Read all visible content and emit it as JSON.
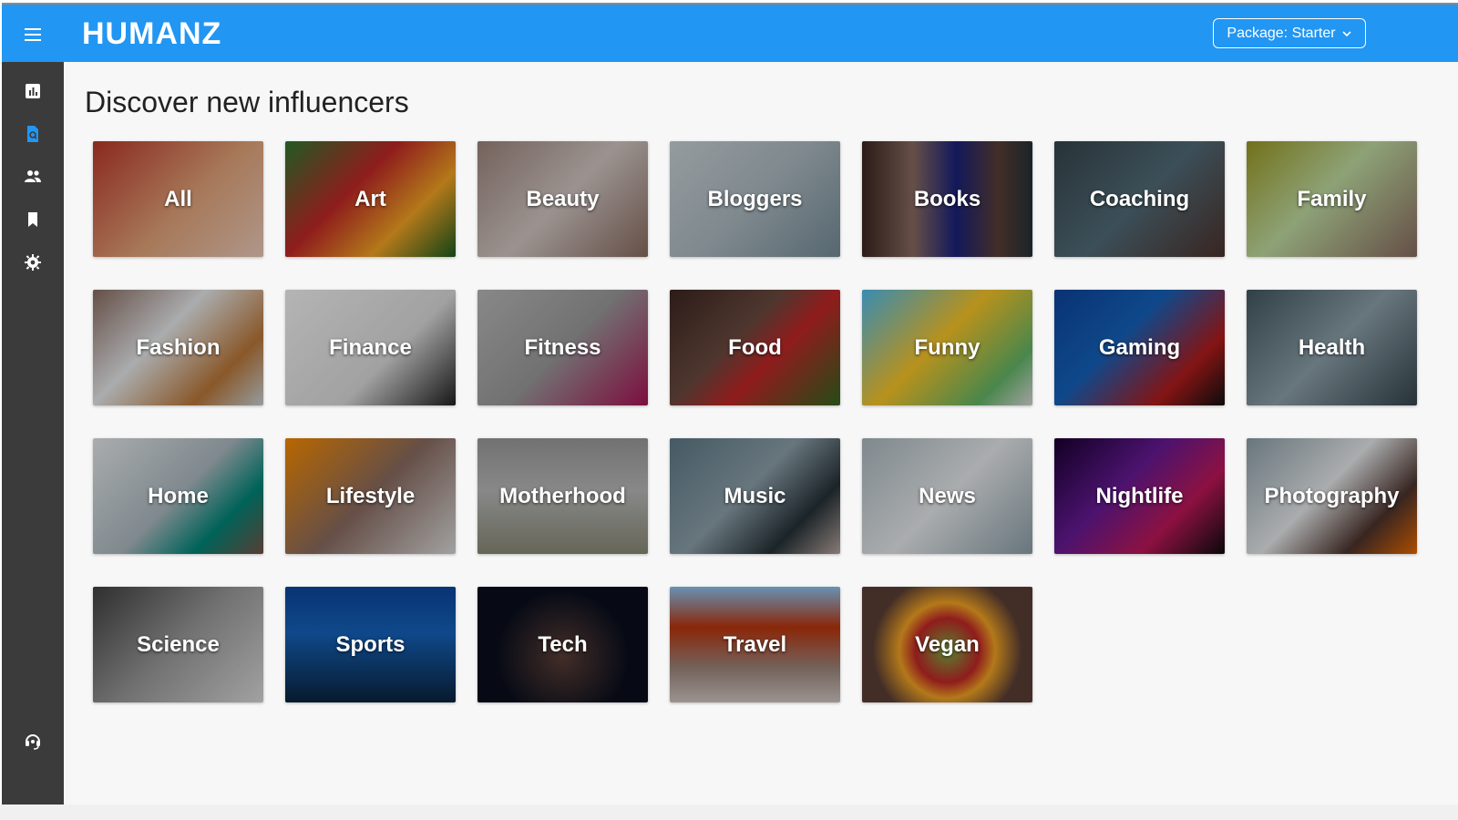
{
  "header": {
    "logo_text": "HUMANZ",
    "package_label": "Package: Starter"
  },
  "page": {
    "title": "Discover new influencers"
  },
  "colors": {
    "brand_blue": "#2196f3",
    "sidebar_bg": "#3b3b3b",
    "page_bg": "#f7f7f7"
  },
  "sidebar": {
    "items": [
      {
        "icon": "bar-chart-icon",
        "active": false
      },
      {
        "icon": "search-document-icon",
        "active": true
      },
      {
        "icon": "people-icon",
        "active": false
      },
      {
        "icon": "bookmark-icon",
        "active": false
      },
      {
        "icon": "gear-icon",
        "active": false
      }
    ],
    "bottom_icon": "support-headset-icon"
  },
  "categories": [
    {
      "label": "All",
      "bg": "linear-gradient(135deg,#c0392b,#e8a87c 55%,#f3d1c0)"
    },
    {
      "label": "Art",
      "bg": "linear-gradient(135deg,#2e7d32,#c62828 40%,#f9a825 70%,#1b5e20)"
    },
    {
      "label": "Beauty",
      "bg": "linear-gradient(135deg,#a1887f,#d7ccc8 50%,#8d6e63)"
    },
    {
      "label": "Bloggers",
      "bg": "linear-gradient(135deg,#cfd8dc,#b0bec5 50%,#78909c)"
    },
    {
      "label": "Books",
      "bg": "linear-gradient(90deg,#3e2723,#8d6e63 30%,#1a237e 55%,#5d4037 80%,#263238)"
    },
    {
      "label": "Coaching",
      "bg": "linear-gradient(135deg,#37474f,#546e7a 50%,#4e342e)"
    },
    {
      "label": "Family",
      "bg": "linear-gradient(135deg,#9e9d24,#c5e1a5 45%,#8d6e63)"
    },
    {
      "label": "Fashion",
      "bg": "linear-gradient(135deg,#8d6e63,#eceff1 40%,#bf7a3a 75%,#cfd8dc)"
    },
    {
      "label": "Finance",
      "bg": "linear-gradient(135deg,#fafafa,#e0e0e0 60%,#212121)"
    },
    {
      "label": "Fitness",
      "bg": "linear-gradient(135deg,#bdbdbd,#9e9e9e 50%,#ad1457)"
    },
    {
      "label": "Food",
      "bg": "linear-gradient(135deg,#3e2723,#6d4c41 40%,#c62828 60%,#33691e)"
    },
    {
      "label": "Funny",
      "bg": "linear-gradient(135deg,#4fc3f7,#ffca28 45%,#66bb6a 80%,#e0e0e0)"
    },
    {
      "label": "Gaming",
      "bg": "linear-gradient(135deg,#0d47a1,#1565c0 40%,#b71c1c 75%,#111)"
    },
    {
      "label": "Health",
      "bg": "linear-gradient(135deg,#455a64,#90a4ae 50%,#37474f)"
    },
    {
      "label": "Home",
      "bg": "linear-gradient(135deg,#eceff1,#b0bec5 50%,#00897b 75%,#795548)"
    },
    {
      "label": "Lifestyle",
      "bg": "linear-gradient(135deg,#ff8f00,#8d6e63 50%,#e0e0e0)"
    },
    {
      "label": "Motherhood",
      "bg": "linear-gradient(180deg,#9e9e9e,#bdbdbd 45%,#8d8d7a)"
    },
    {
      "label": "Music",
      "bg": "linear-gradient(135deg,#607d8b,#90a4ae 45%,#263238 75%,#bcaaa4)"
    },
    {
      "label": "News",
      "bg": "linear-gradient(135deg,#b0bec5,#eceff1 50%,#90a4ae)"
    },
    {
      "label": "Nightlife",
      "bg": "linear-gradient(135deg,#1a0033,#6a1b9a 40%,#c2185b 70%,#0d0d0d)"
    },
    {
      "label": "Photography",
      "bg": "linear-gradient(135deg,#90a4ae,#eceff1 45%,#4e342e 75%,#ef6c00)"
    },
    {
      "label": "Science",
      "bg": "linear-gradient(135deg,#424242,#9e9e9e 50%,#e0e0e0)"
    },
    {
      "label": "Sports",
      "bg": "linear-gradient(180deg,#0d47a1,#1565c0 40%,#0a2540)"
    },
    {
      "label": "Tech",
      "bg": "radial-gradient(circle at 50% 60%,#5d4037,#0a0f1e 60%)"
    },
    {
      "label": "Travel",
      "bg": "linear-gradient(180deg,#90caf9,#bf360c 35%,#a1887f 70%,#d7ccc8)"
    },
    {
      "label": "Vegan",
      "bg": "radial-gradient(circle at 50% 55%,#7cb342,#c62828 30%,#f9a825 45%,#5d4037 70%)"
    }
  ]
}
